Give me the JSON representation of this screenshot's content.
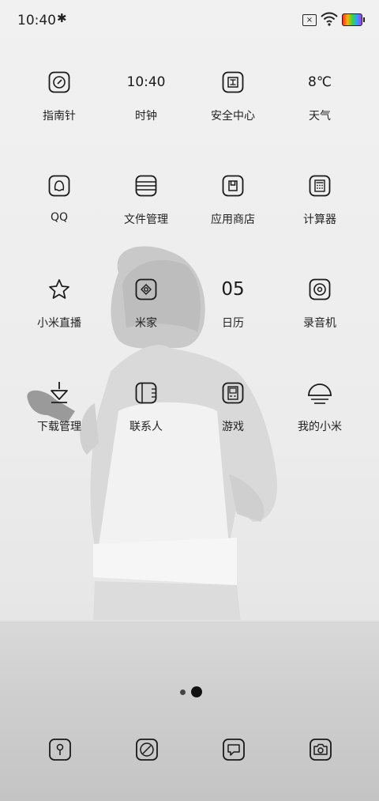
{
  "status_bar": {
    "time": "10:40",
    "bluetooth_icon": "bluetooth-icon",
    "sim_icon": "sim-no-service-icon",
    "wifi_icon": "wifi-icon",
    "battery_icon": "battery-charging-icon"
  },
  "apps": [
    {
      "label": "指南针",
      "icon": "compass-icon"
    },
    {
      "label": "时钟",
      "icon_text": "10:40"
    },
    {
      "label": "安全中心",
      "icon": "security-center-icon"
    },
    {
      "label": "天气",
      "icon_text": "8℃"
    },
    {
      "label": "QQ",
      "icon": "qq-icon"
    },
    {
      "label": "文件管理",
      "icon": "file-manager-icon"
    },
    {
      "label": "应用商店",
      "icon": "app-store-icon"
    },
    {
      "label": "计算器",
      "icon": "calculator-icon"
    },
    {
      "label": "小米直播",
      "icon": "star-icon"
    },
    {
      "label": "米家",
      "icon": "mijia-icon"
    },
    {
      "label": "日历",
      "icon_text": "05"
    },
    {
      "label": "录音机",
      "icon": "recorder-icon"
    },
    {
      "label": "下载管理",
      "icon": "download-icon"
    },
    {
      "label": "联系人",
      "icon": "contacts-icon"
    },
    {
      "label": "游戏",
      "icon": "games-icon"
    },
    {
      "label": "我的小米",
      "icon": "sunset-icon"
    }
  ],
  "pager": {
    "pages": 2,
    "current": 2
  },
  "dock": [
    {
      "icon": "phone-icon"
    },
    {
      "icon": "browser-icon"
    },
    {
      "icon": "messages-icon"
    },
    {
      "icon": "camera-icon"
    }
  ],
  "colors": {
    "icon_stroke": "#1a1a1a",
    "wallpaper": "#eeeeee"
  }
}
